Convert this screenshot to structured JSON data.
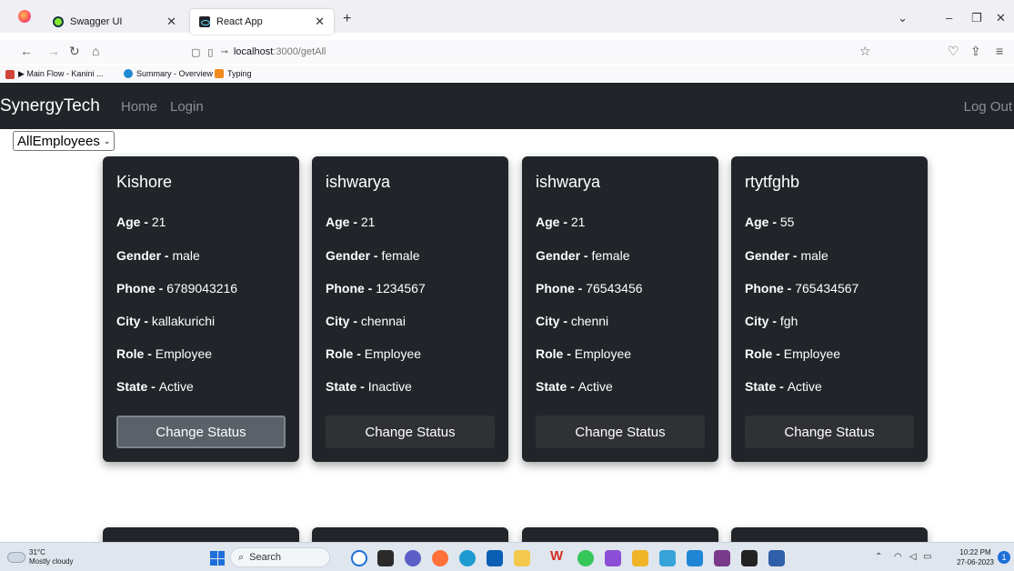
{
  "browser": {
    "tabs": [
      {
        "title": "Swagger UI"
      },
      {
        "title": "React App"
      }
    ],
    "url_host": "localhost",
    "url_rest": ":3000/getAll",
    "bookmarks": [
      "▶ Main Flow - Kanini ...",
      "Summary - Overview",
      "Typing"
    ]
  },
  "app": {
    "brand": "SynergyTech",
    "nav": [
      "Home",
      "Login"
    ],
    "logout": "Log Out",
    "filter": {
      "selected": "AllEmployees"
    }
  },
  "labels": {
    "age": "Age - ",
    "gender": "Gender - ",
    "phone": "Phone - ",
    "city": "City - ",
    "role": "Role - ",
    "state": "State - ",
    "change_status": "Change Status"
  },
  "employees": [
    {
      "name": "Kishore",
      "age": "21",
      "gender": "male",
      "phone": "6789043216",
      "city": "kallakurichi",
      "role": "Employee",
      "state": "Active"
    },
    {
      "name": "ishwarya",
      "age": "21",
      "gender": "female",
      "phone": "1234567",
      "city": "chennai",
      "role": "Employee",
      "state": "Inactive"
    },
    {
      "name": "ishwarya",
      "age": "21",
      "gender": "female",
      "phone": "76543456",
      "city": "chenni",
      "role": "Employee",
      "state": "Active"
    },
    {
      "name": "rtytfghb",
      "age": "55",
      "gender": "male",
      "phone": "765434567",
      "city": "fgh",
      "role": "Employee",
      "state": "Active"
    }
  ],
  "taskbar": {
    "temp": "31°C",
    "weather": "Mostly cloudy",
    "search": "Search",
    "time": "10:22 PM",
    "date": "27-06-2023",
    "notifications": "1"
  },
  "colors": {
    "app_bar": "#212529",
    "card": "#212529",
    "button": "#2f3134",
    "button_active": "#5a6169"
  }
}
